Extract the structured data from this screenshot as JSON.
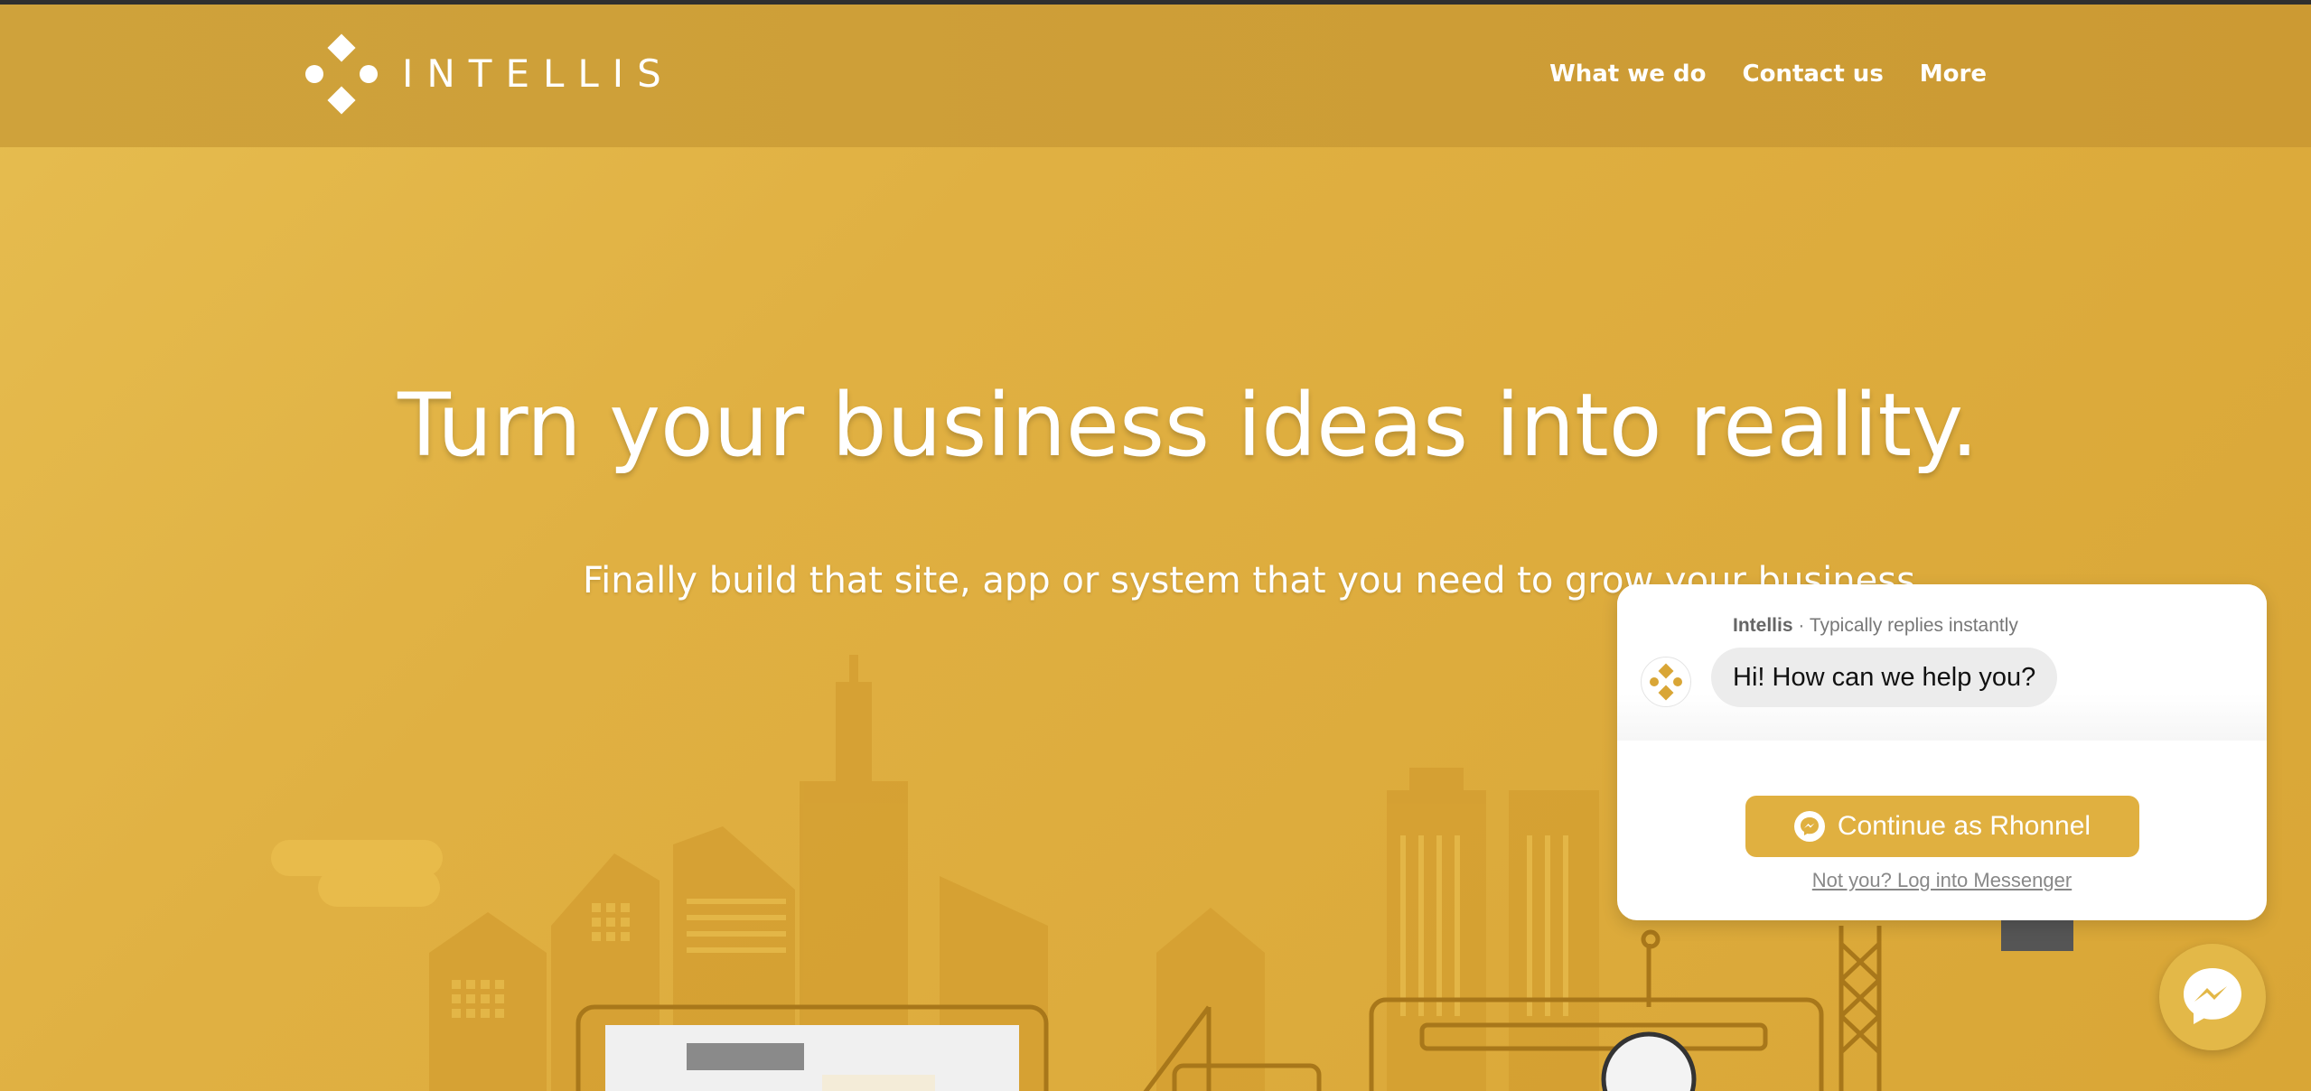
{
  "brand": {
    "name": "INTELLIS"
  },
  "nav": {
    "items": [
      "What we do",
      "Contact us",
      "More"
    ]
  },
  "hero": {
    "headline": "Turn your business ideas into reality.",
    "subhead": "Finally build that site, app or system that you need to grow your business."
  },
  "chat": {
    "page_name": "Intellis",
    "reply_time": "· Typically replies instantly",
    "greeting": "Hi! How can we help you?",
    "continue_label": "Continue as Rhonnel",
    "not_you_link": "Not you? Log into Messenger"
  },
  "icons": {
    "logo": "intellis-diamond-logo",
    "messenger": "messenger-icon"
  },
  "colors": {
    "accent": "#e0b040",
    "navbar": "#cfa23b",
    "hero": "#e0b042"
  }
}
